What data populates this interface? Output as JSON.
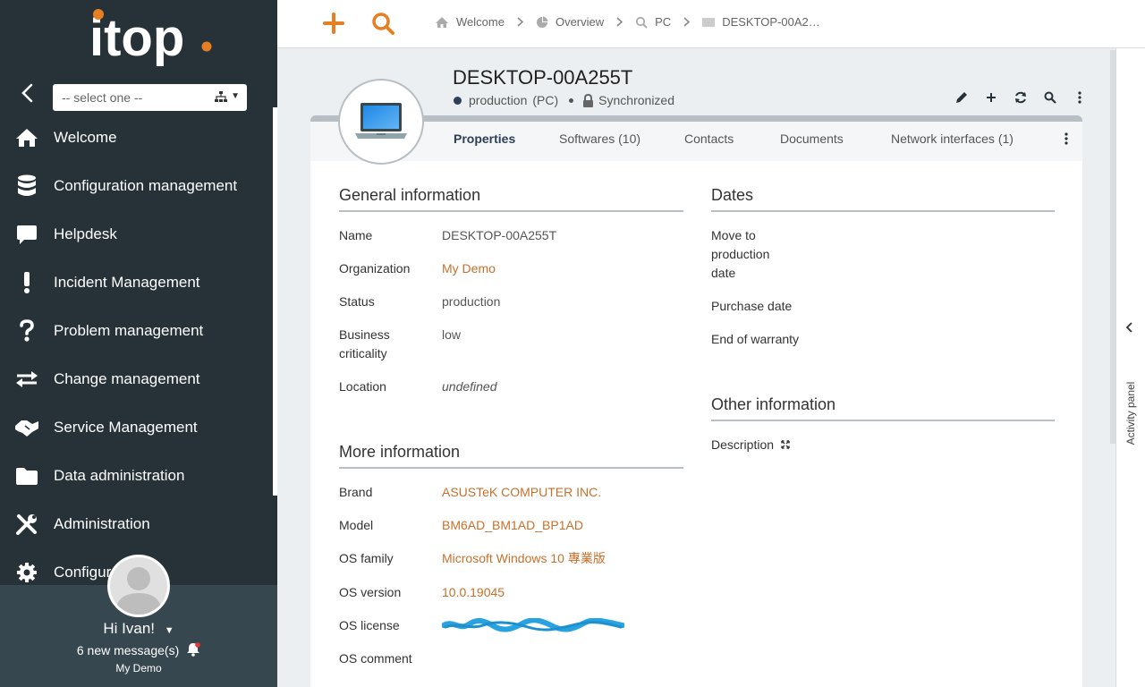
{
  "sidebar": {
    "org_select_placeholder": "-- select one --",
    "menu": [
      {
        "label": "Welcome",
        "icon": "home-icon"
      },
      {
        "label": "Configuration management",
        "icon": "database-icon"
      },
      {
        "label": "Helpdesk",
        "icon": "speech-bubble-icon"
      },
      {
        "label": "Incident Management",
        "icon": "exclamation-icon"
      },
      {
        "label": "Problem management",
        "icon": "question-icon"
      },
      {
        "label": "Change management",
        "icon": "exchange-arrows-icon"
      },
      {
        "label": "Service Management",
        "icon": "handshake-icon"
      },
      {
        "label": "Data administration",
        "icon": "folder-icon"
      },
      {
        "label": "Administration",
        "icon": "tools-icon"
      },
      {
        "label": "Configur",
        "icon": "gear-icon"
      }
    ],
    "user": {
      "greeting": "Hi Ivan!",
      "messages": "6 new message(s)",
      "organization": "My Demo"
    }
  },
  "breadcrumb": [
    {
      "label": "Welcome",
      "icon": "home-icon"
    },
    {
      "label": "Overview",
      "icon": "pie-chart-icon"
    },
    {
      "label": "PC",
      "icon": "search-icon"
    },
    {
      "label": "DESKTOP-00A2…",
      "icon": "desktop-icon"
    }
  ],
  "object": {
    "title": "DESKTOP-00A255T",
    "status": "production",
    "class": "(PC)",
    "sync": "Synchronized"
  },
  "tabs": [
    {
      "label": "Properties",
      "active": true
    },
    {
      "label": "Softwares (10)",
      "active": false
    },
    {
      "label": "Contacts",
      "active": false
    },
    {
      "label": "Documents",
      "active": false
    },
    {
      "label": "Network interfaces (1)",
      "active": false
    }
  ],
  "general": {
    "title": "General information",
    "fields": {
      "name": {
        "label": "Name",
        "value": "DESKTOP-00A255T"
      },
      "organization": {
        "label": "Organization",
        "value": "My Demo"
      },
      "status": {
        "label": "Status",
        "value": "production"
      },
      "criticality": {
        "label": "Business criticality",
        "value": "low"
      },
      "location": {
        "label": "Location",
        "value": "undefined"
      }
    }
  },
  "more": {
    "title": "More information",
    "fields": {
      "brand": {
        "label": "Brand",
        "value": "ASUSTeK COMPUTER INC."
      },
      "model": {
        "label": "Model",
        "value": "BM6AD_BM1AD_BP1AD"
      },
      "os_family": {
        "label": "OS family",
        "value": "Microsoft Windows 10 專業版"
      },
      "os_version": {
        "label": "OS version",
        "value": "10.0.19045"
      },
      "os_license": {
        "label": "OS license",
        "value": ""
      },
      "os_comment": {
        "label": "OS comment",
        "value": ""
      }
    }
  },
  "dates": {
    "title": "Dates",
    "fields": {
      "move_to_production": {
        "label": "Move to production date",
        "value": ""
      },
      "purchase": {
        "label": "Purchase date",
        "value": ""
      },
      "warranty": {
        "label": "End of warranty",
        "value": ""
      }
    }
  },
  "other": {
    "title": "Other information",
    "description_label": "Description"
  },
  "activity_panel_label": "Activity panel",
  "colors": {
    "sidebar_bg": "#263238",
    "accent_orange": "#e67e22",
    "link": "#c8702b",
    "status_dot": "#2e4057"
  }
}
